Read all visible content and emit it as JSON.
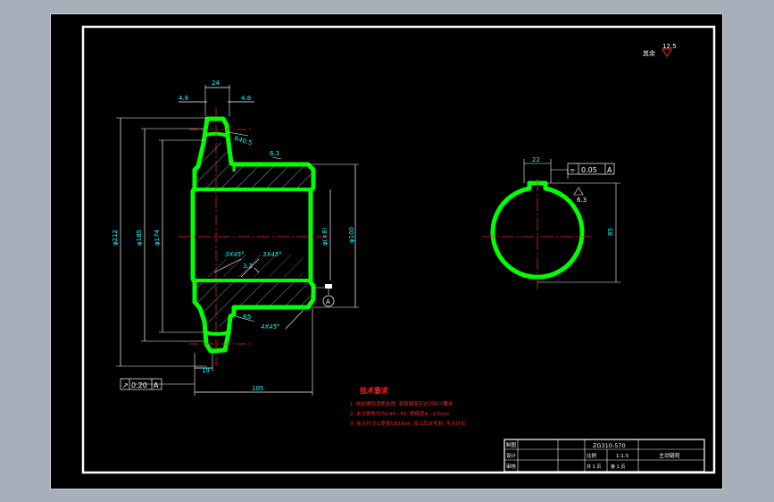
{
  "colors": {
    "background": "#a7b0ba",
    "viewport": "#000000",
    "frame": "#ffffff",
    "outline": "#00ff00",
    "dimension": "#00ffff",
    "centerline": "#ff0000",
    "hatch": "#ffffff",
    "note": "#ff2020"
  },
  "surface_roughness": {
    "label": "其余",
    "value": "12.5"
  },
  "side_view": {
    "dims": {
      "top_width": "24",
      "left_chamfer": "4.8",
      "right_chamfer": "4.8",
      "tooth_radius": "R40.5",
      "roughness_top": "6.3",
      "d212": "φ212",
      "d185": "φ185",
      "d174": "φ174",
      "d100": "φ100",
      "d48": "φ(×8)",
      "chamfer1": "3X45°",
      "chamfer2": "3X45°",
      "roughness_mid": "3.2",
      "fillet": "R5",
      "chamfer3": "4X45°",
      "tooth_width": "19",
      "total_length": "105",
      "datum": "A"
    },
    "tolerance_frame": {
      "symbol": "↗",
      "value": "0.20",
      "datum": "A"
    }
  },
  "section_view": {
    "keyway_width": "22",
    "depth": "85",
    "roughness": "6.3",
    "tolerance_frame": {
      "symbol": "⌯",
      "value": "0.05",
      "datum": "A"
    }
  },
  "tech_notes": {
    "title": "技术要求",
    "lines": [
      "1. 热处理后调质处理, 表面硬度应达到设计要求",
      "2. 未注倒角均为C45—50, 粗糙度4—2.5mm",
      "3. 未注尺寸公差按GB1804, 加工后去毛刺, 不允许有"
    ]
  },
  "title_block": {
    "drawing_no": "ZG310-570",
    "scale_label": "比例",
    "scale": "1:1.5",
    "name": "主动链轮",
    "sheet_total": "共 1 页",
    "sheet_no": "第 1 页",
    "rows": [
      "制图",
      "设计",
      "审核"
    ]
  }
}
